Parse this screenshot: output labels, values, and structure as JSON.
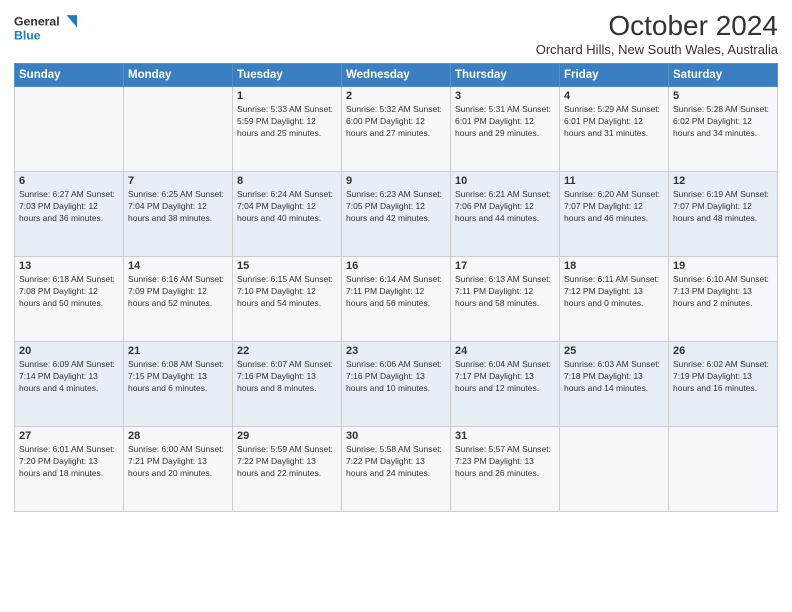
{
  "logo": {
    "line1": "General",
    "line2": "Blue"
  },
  "title": "October 2024",
  "subtitle": "Orchard Hills, New South Wales, Australia",
  "days_of_week": [
    "Sunday",
    "Monday",
    "Tuesday",
    "Wednesday",
    "Thursday",
    "Friday",
    "Saturday"
  ],
  "weeks": [
    [
      {
        "day": "",
        "detail": ""
      },
      {
        "day": "",
        "detail": ""
      },
      {
        "day": "1",
        "detail": "Sunrise: 5:33 AM\nSunset: 5:59 PM\nDaylight: 12 hours\nand 25 minutes."
      },
      {
        "day": "2",
        "detail": "Sunrise: 5:32 AM\nSunset: 6:00 PM\nDaylight: 12 hours\nand 27 minutes."
      },
      {
        "day": "3",
        "detail": "Sunrise: 5:31 AM\nSunset: 6:01 PM\nDaylight: 12 hours\nand 29 minutes."
      },
      {
        "day": "4",
        "detail": "Sunrise: 5:29 AM\nSunset: 6:01 PM\nDaylight: 12 hours\nand 31 minutes."
      },
      {
        "day": "5",
        "detail": "Sunrise: 5:28 AM\nSunset: 6:02 PM\nDaylight: 12 hours\nand 34 minutes."
      }
    ],
    [
      {
        "day": "6",
        "detail": "Sunrise: 6:27 AM\nSunset: 7:03 PM\nDaylight: 12 hours\nand 36 minutes."
      },
      {
        "day": "7",
        "detail": "Sunrise: 6:25 AM\nSunset: 7:04 PM\nDaylight: 12 hours\nand 38 minutes."
      },
      {
        "day": "8",
        "detail": "Sunrise: 6:24 AM\nSunset: 7:04 PM\nDaylight: 12 hours\nand 40 minutes."
      },
      {
        "day": "9",
        "detail": "Sunrise: 6:23 AM\nSunset: 7:05 PM\nDaylight: 12 hours\nand 42 minutes."
      },
      {
        "day": "10",
        "detail": "Sunrise: 6:21 AM\nSunset: 7:06 PM\nDaylight: 12 hours\nand 44 minutes."
      },
      {
        "day": "11",
        "detail": "Sunrise: 6:20 AM\nSunset: 7:07 PM\nDaylight: 12 hours\nand 46 minutes."
      },
      {
        "day": "12",
        "detail": "Sunrise: 6:19 AM\nSunset: 7:07 PM\nDaylight: 12 hours\nand 48 minutes."
      }
    ],
    [
      {
        "day": "13",
        "detail": "Sunrise: 6:18 AM\nSunset: 7:08 PM\nDaylight: 12 hours\nand 50 minutes."
      },
      {
        "day": "14",
        "detail": "Sunrise: 6:16 AM\nSunset: 7:09 PM\nDaylight: 12 hours\nand 52 minutes."
      },
      {
        "day": "15",
        "detail": "Sunrise: 6:15 AM\nSunset: 7:10 PM\nDaylight: 12 hours\nand 54 minutes."
      },
      {
        "day": "16",
        "detail": "Sunrise: 6:14 AM\nSunset: 7:11 PM\nDaylight: 12 hours\nand 56 minutes."
      },
      {
        "day": "17",
        "detail": "Sunrise: 6:13 AM\nSunset: 7:11 PM\nDaylight: 12 hours\nand 58 minutes."
      },
      {
        "day": "18",
        "detail": "Sunrise: 6:11 AM\nSunset: 7:12 PM\nDaylight: 13 hours\nand 0 minutes."
      },
      {
        "day": "19",
        "detail": "Sunrise: 6:10 AM\nSunset: 7:13 PM\nDaylight: 13 hours\nand 2 minutes."
      }
    ],
    [
      {
        "day": "20",
        "detail": "Sunrise: 6:09 AM\nSunset: 7:14 PM\nDaylight: 13 hours\nand 4 minutes."
      },
      {
        "day": "21",
        "detail": "Sunrise: 6:08 AM\nSunset: 7:15 PM\nDaylight: 13 hours\nand 6 minutes."
      },
      {
        "day": "22",
        "detail": "Sunrise: 6:07 AM\nSunset: 7:16 PM\nDaylight: 13 hours\nand 8 minutes."
      },
      {
        "day": "23",
        "detail": "Sunrise: 6:06 AM\nSunset: 7:16 PM\nDaylight: 13 hours\nand 10 minutes."
      },
      {
        "day": "24",
        "detail": "Sunrise: 6:04 AM\nSunset: 7:17 PM\nDaylight: 13 hours\nand 12 minutes."
      },
      {
        "day": "25",
        "detail": "Sunrise: 6:03 AM\nSunset: 7:18 PM\nDaylight: 13 hours\nand 14 minutes."
      },
      {
        "day": "26",
        "detail": "Sunrise: 6:02 AM\nSunset: 7:19 PM\nDaylight: 13 hours\nand 16 minutes."
      }
    ],
    [
      {
        "day": "27",
        "detail": "Sunrise: 6:01 AM\nSunset: 7:20 PM\nDaylight: 13 hours\nand 18 minutes."
      },
      {
        "day": "28",
        "detail": "Sunrise: 6:00 AM\nSunset: 7:21 PM\nDaylight: 13 hours\nand 20 minutes."
      },
      {
        "day": "29",
        "detail": "Sunrise: 5:59 AM\nSunset: 7:22 PM\nDaylight: 13 hours\nand 22 minutes."
      },
      {
        "day": "30",
        "detail": "Sunrise: 5:58 AM\nSunset: 7:22 PM\nDaylight: 13 hours\nand 24 minutes."
      },
      {
        "day": "31",
        "detail": "Sunrise: 5:57 AM\nSunset: 7:23 PM\nDaylight: 13 hours\nand 26 minutes."
      },
      {
        "day": "",
        "detail": ""
      },
      {
        "day": "",
        "detail": ""
      }
    ]
  ]
}
